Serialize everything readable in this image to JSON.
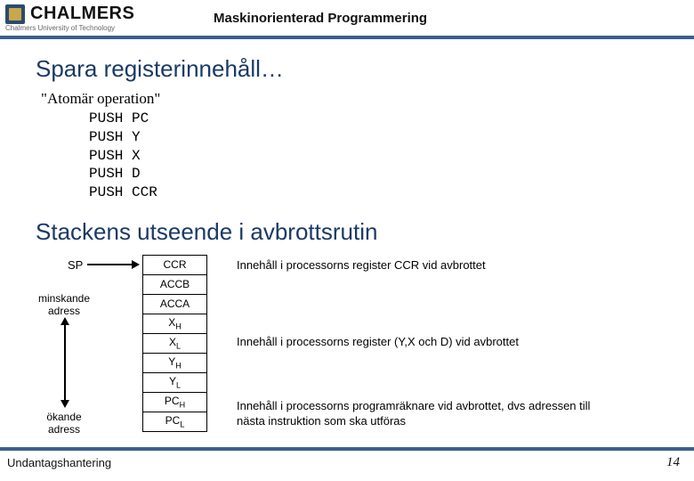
{
  "header": {
    "logo_text": "CHALMERS",
    "logo_sub": "Chalmers University of Technology",
    "title": "Maskinorienterad Programmering"
  },
  "titles": {
    "t1": "Spara registerinnehåll…",
    "atomic": "\"Atomär operation\"",
    "t2": "Stackens utseende i avbrottsrutin"
  },
  "push": {
    "l1": "PUSH PC",
    "l2": "PUSH Y",
    "l3": "PUSH X",
    "l4": "PUSH D",
    "l5": "PUSH CCR"
  },
  "labels": {
    "sp": "SP",
    "minsk1": "minskande",
    "minsk2": "adress",
    "oka1": "ökande",
    "oka2": "adress"
  },
  "stack": {
    "r0": "CCR",
    "r1": "ACCB",
    "r2": "ACCA",
    "r3a": "X",
    "r3b": "H",
    "r4a": "X",
    "r4b": "L",
    "r5a": "Y",
    "r5b": "H",
    "r6a": "Y",
    "r6b": "L",
    "r7a": "PC",
    "r7b": "H",
    "r8a": "PC",
    "r8b": "L"
  },
  "desc": {
    "d1": "Innehåll i processorns register CCR  vid avbrottet",
    "d2": "Innehåll i processorns register (Y,X och D)  vid avbrottet",
    "d3": "Innehåll i processorns programräknare vid avbrottet, dvs adressen till nästa instruktion som ska utföras"
  },
  "footer": {
    "left": "Undantagshantering",
    "right": "14"
  }
}
